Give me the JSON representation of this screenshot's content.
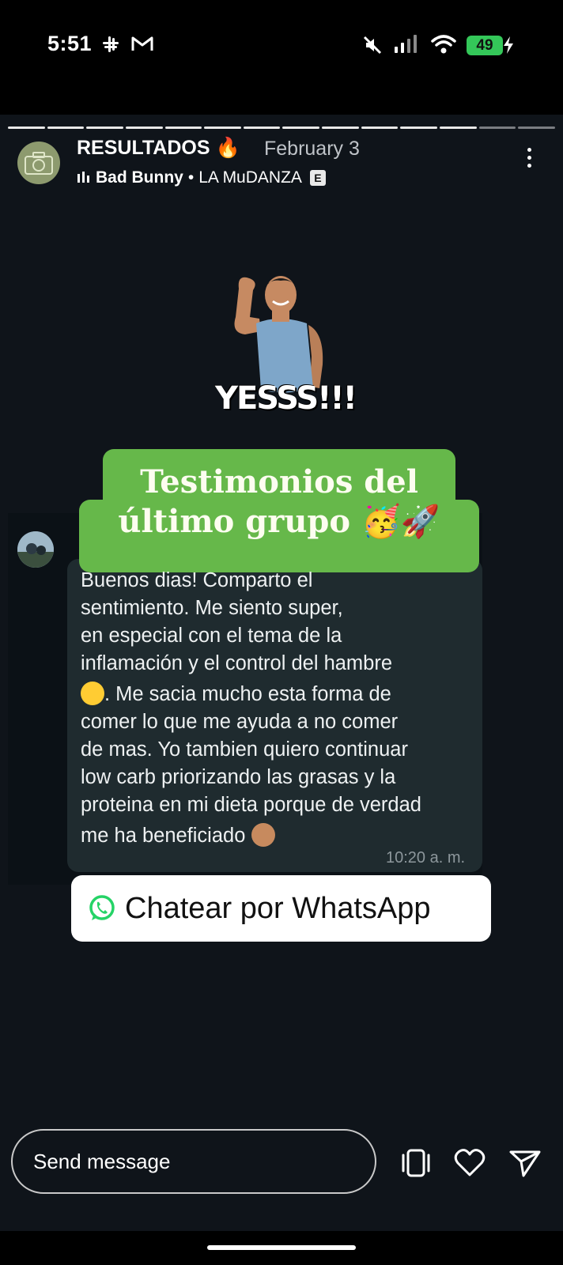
{
  "status_bar": {
    "time": "5:51",
    "battery": "49"
  },
  "story": {
    "account_name": "RESULTADOS",
    "account_emoji": "🔥",
    "date": "February 3",
    "music_artist": "Bad Bunny",
    "music_separator": "•",
    "music_song": "LA MuDANZA",
    "explicit_badge": "E",
    "progress_segments_total": 14,
    "progress_segments_viewed": 12
  },
  "sticker": {
    "text": "YESSS!!!"
  },
  "banner": {
    "line1": "Testimonios del",
    "line2": "último grupo 🥳🚀"
  },
  "chat": {
    "message_lines": [
      "Buenos dias! Comparto el",
      "sentimiento. Me siento super,",
      "en especial con el tema de la",
      "inflamación y el control del hambre",
      ". Me sacia mucho esta forma de",
      "comer lo que me ayuda a no comer",
      "de mas. Yo tambien quiero continuar",
      "low carb priorizando las grasas y la",
      "proteina en mi dieta porque de verdad",
      "me ha beneficiado"
    ],
    "timestamp": "10:20 a. m."
  },
  "cta": {
    "label": "Chatear por WhatsApp"
  },
  "composer": {
    "placeholder": "Send message"
  },
  "icons": {
    "status": [
      "slack-icon",
      "gmail-icon",
      "mute-icon",
      "signal-icon",
      "wifi-icon",
      "battery-icon"
    ],
    "actions": [
      "more-icon",
      "reshare-icon",
      "heart-icon",
      "send-icon"
    ]
  },
  "colors": {
    "banner_green": "#66b84a",
    "bubble": "#1f2b2f",
    "story_bg": "#0f141a",
    "battery_green": "#34c759",
    "whatsapp_green": "#25d366"
  }
}
